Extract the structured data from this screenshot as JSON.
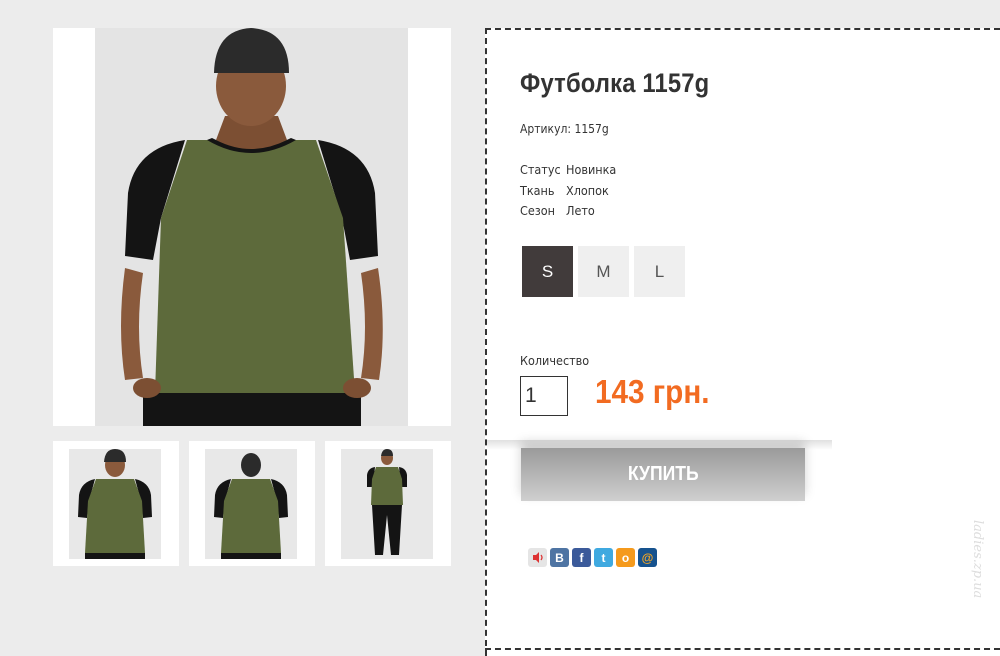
{
  "product": {
    "title": "Футболка 1157g",
    "sku_label": "Артикул: 1157g",
    "properties": [
      {
        "key": "Статус",
        "value": "Новинка"
      },
      {
        "key": "Ткань",
        "value": "Хлопок"
      },
      {
        "key": "Сезон",
        "value": "Лето"
      }
    ],
    "sizes": [
      {
        "label": "S",
        "selected": true
      },
      {
        "label": "M",
        "selected": false
      },
      {
        "label": "L",
        "selected": false
      }
    ],
    "quantity_label": "Количество",
    "quantity_value": "1",
    "price": "143 грн.",
    "buy_label": "КУПИТЬ"
  },
  "gallery": {
    "thumbnails": [
      "front",
      "back",
      "full-length"
    ]
  },
  "social": [
    {
      "icon": "speaker-share-icon",
      "color": "#e5e5e5"
    },
    {
      "icon": "vkontakte-icon",
      "label": "В",
      "color": "#4e74a3"
    },
    {
      "icon": "facebook-icon",
      "label": "f",
      "color": "#3b5a9a"
    },
    {
      "icon": "twitter-icon",
      "label": "t",
      "color": "#3fa9e0"
    },
    {
      "icon": "odnoklassniki-icon",
      "label": "о",
      "color": "#f59a1c"
    },
    {
      "icon": "mailru-icon",
      "label": "@",
      "color": "#16528e"
    }
  ],
  "watermark": "ladies.zp.ua",
  "colors": {
    "accent_price": "#f26b21",
    "selected_size_bg": "#413b3b",
    "shirt_body": "#5d6a3b",
    "shirt_sleeves": "#141414"
  }
}
